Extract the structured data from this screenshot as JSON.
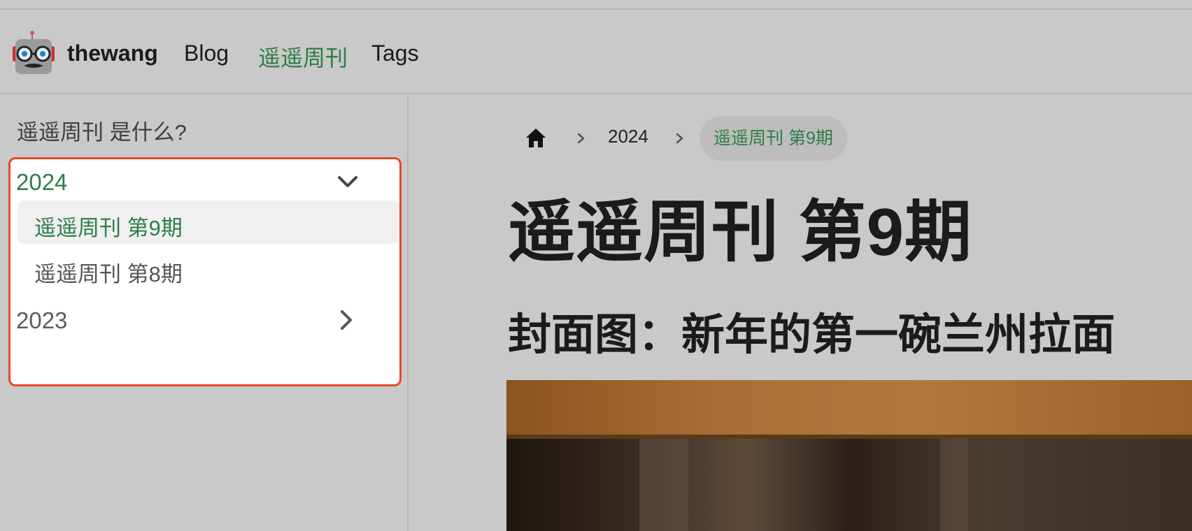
{
  "site": {
    "name": "thewang"
  },
  "nav": {
    "links": [
      {
        "label": "Blog"
      },
      {
        "label": "遥遥周刊"
      },
      {
        "label": "Tags"
      }
    ]
  },
  "sidebar": {
    "about_link": "遥遥周刊 是什么?",
    "years": [
      {
        "label": "2024",
        "state": "expanded",
        "issues": [
          {
            "label": "遥遥周刊 第9期",
            "selected": true
          },
          {
            "label": "遥遥周刊 第8期",
            "selected": false
          }
        ]
      },
      {
        "label": "2023",
        "state": "collapsed"
      }
    ]
  },
  "breadcrumb": {
    "home_icon": "home-icon",
    "items": [
      "2024",
      "遥遥周刊 第9期"
    ]
  },
  "article": {
    "title": "遥遥周刊 第9期",
    "cover_heading": "封面图：新年的第一碗兰州拉面"
  },
  "colors": {
    "accent": "#2e7d4a",
    "highlight_border": "#e44a2e",
    "background": "#c9c9c9"
  }
}
